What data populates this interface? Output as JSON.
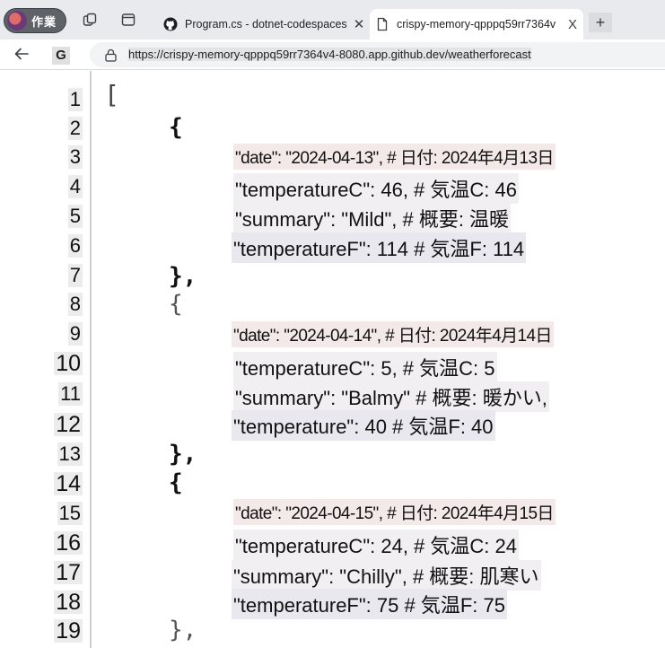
{
  "browser": {
    "profile_label": "作業",
    "tabs": [
      {
        "label": "Program.cs - dotnet-codespaces",
        "close": "✕",
        "active": false
      },
      {
        "label": "crispy-memory-qpppq59rr7364v",
        "close": "X",
        "active": true
      }
    ],
    "new_tab": "+",
    "address": {
      "go_label": "G",
      "url": "https://crispy-memory-qpppq59rr7364v4-8080.app.github.dev/weatherforecast"
    }
  },
  "viewer": {
    "line_numbers": [
      "1",
      "2",
      "3",
      "4",
      "5",
      "6",
      "7",
      "8",
      "9",
      "10",
      "11",
      "12",
      "13",
      "14",
      "15",
      "16",
      "17",
      "18",
      "19"
    ],
    "open_bracket": "[",
    "open_brace": "{",
    "close_brace": "},",
    "entries": [
      {
        "date": "\"date\": \"2024-04-13\", # 日付: 2024年4月13日",
        "temperatureC": "\"temperatureC\": 46, # 気温C: 46",
        "summary": "\"summary\": \"Mild\", # 概要: 温暖",
        "temperatureF": "\"temperatureF\": 114 # 気温F: 114"
      },
      {
        "date": "\"date\": \"2024-04-14\", # 日付: 2024年4月14日",
        "temperatureC": "\"temperatureC\": 5, # 気温C: 5",
        "summary": "\"summary\": \"Balmy\" # 概要: 暖かい,",
        "temperatureF": "\"temperature\": 40 # 気温F: 40"
      },
      {
        "date": "\"date\": \"2024-04-15\", # 日付: 2024年4月15日",
        "temperatureC": "\"temperatureC\": 24, # 気温C: 24",
        "summary": "\"summary\": \"Chilly\", # 概要: 肌寒い",
        "temperatureF": "\"temperatureF\": 75 # 気温F: 75"
      }
    ]
  }
}
